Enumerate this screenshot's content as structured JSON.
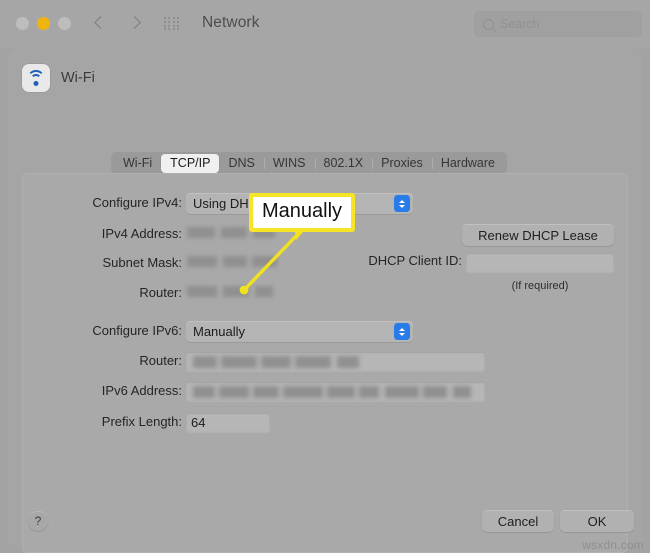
{
  "window": {
    "title": "Network",
    "traffic_lights": [
      {
        "name": "close",
        "color": "#bdbdbd"
      },
      {
        "name": "minimize",
        "color": "#f0b411"
      },
      {
        "name": "zoom",
        "color": "#bdbdbd"
      }
    ],
    "nav_back_icon": "chevron-left-icon",
    "nav_forward_icon": "chevron-right-icon",
    "grid_icon": "grid-apps-icon",
    "search": {
      "icon": "search-icon",
      "placeholder": "Search",
      "value": ""
    }
  },
  "sheet": {
    "interface_label": "Wi-Fi",
    "interface_icon": "wifi-icon",
    "tabs": [
      {
        "label": "Wi-Fi",
        "active": false
      },
      {
        "label": "TCP/IP",
        "active": true
      },
      {
        "label": "DNS",
        "active": false
      },
      {
        "label": "WINS",
        "active": false
      },
      {
        "label": "802.1X",
        "active": false
      },
      {
        "label": "Proxies",
        "active": false
      },
      {
        "label": "Hardware",
        "active": false
      }
    ]
  },
  "form": {
    "configure_ipv4": {
      "label": "Configure IPv4:",
      "value": "Using DHCP"
    },
    "ipv4_address": {
      "label": "IPv4 Address:",
      "value": "",
      "redacted": true
    },
    "subnet_mask": {
      "label": "Subnet Mask:",
      "value": "",
      "redacted": true
    },
    "ipv4_router": {
      "label": "Router:",
      "value": "",
      "redacted": true
    },
    "renew_dhcp_lease": {
      "label": "Renew DHCP Lease"
    },
    "dhcp_client_id": {
      "label": "DHCP Client ID:",
      "value": "",
      "hint": "(If required)"
    },
    "configure_ipv6": {
      "label": "Configure IPv6:",
      "value": "Manually"
    },
    "ipv6_router": {
      "label": "Router:",
      "value": "",
      "redacted": true
    },
    "ipv6_address": {
      "label": "IPv6 Address:",
      "value": "",
      "redacted": true
    },
    "prefix_length": {
      "label": "Prefix Length:",
      "value": "64"
    }
  },
  "footer": {
    "help_label": "?",
    "cancel_label": "Cancel",
    "ok_label": "OK"
  },
  "annotation": {
    "callout_text": "Manually",
    "callout_border_color": "#f7e427",
    "pointer_color": "#f2e11f"
  },
  "watermark": "wsxdn.com"
}
